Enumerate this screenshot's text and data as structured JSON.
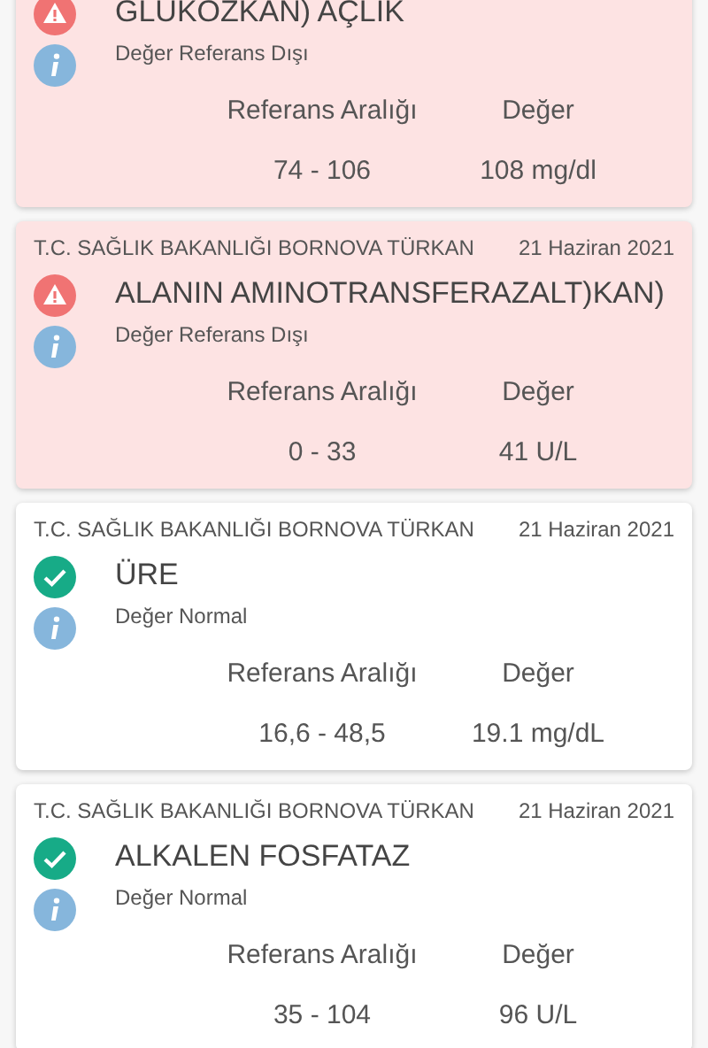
{
  "results": [
    {
      "kind": "abnormal",
      "title": "GLUKOZKAN) AÇLIK",
      "status_text": "Değer Referans Dışı",
      "range_label": "Referans Aralığı",
      "value_label": "Değer",
      "range": "74 - 106",
      "value": "108 mg/dl"
    },
    {
      "kind": "abnormal",
      "institution": "T.C. SAĞLIK BAKANLIĞI BORNOVA TÜRKAN",
      "date": "21 Haziran 2021",
      "title": "ALANIN AMINOTRANSFERAZALT)KAN)",
      "status_text": "Değer Referans Dışı",
      "range_label": "Referans Aralığı",
      "value_label": "Değer",
      "range": "0 - 33",
      "value": "41 U/L"
    },
    {
      "kind": "normal",
      "institution": "T.C. SAĞLIK BAKANLIĞI BORNOVA TÜRKAN",
      "date": "21 Haziran 2021",
      "title": "ÜRE",
      "status_text": "Değer Normal",
      "range_label": "Referans Aralığı",
      "value_label": "Değer",
      "range": "16,6 - 48,5",
      "value": "19.1 mg/dL"
    },
    {
      "kind": "normal",
      "institution": "T.C. SAĞLIK BAKANLIĞI BORNOVA TÜRKAN",
      "date": "21 Haziran 2021",
      "title": "ALKALEN FOSFATAZ",
      "status_text": "Değer Normal",
      "range_label": "Referans Aralığı",
      "value_label": "Değer",
      "range": "35 - 104",
      "value": "96 U/L"
    }
  ]
}
